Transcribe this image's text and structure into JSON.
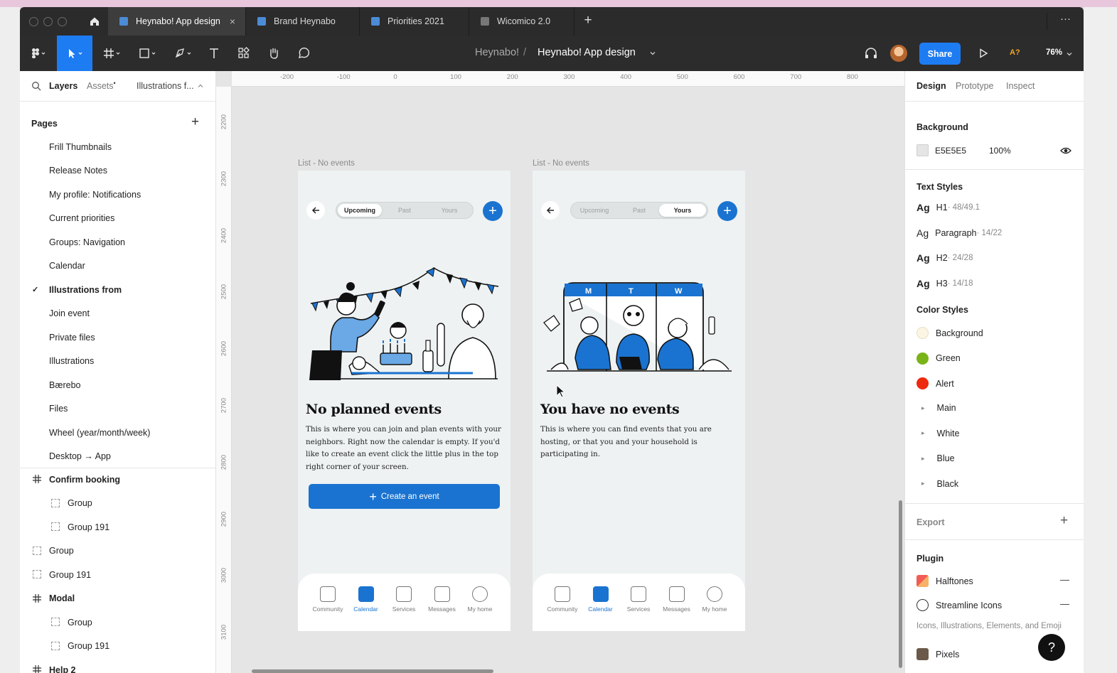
{
  "tabs": [
    {
      "label": "Heynabo! App design",
      "active": true
    },
    {
      "label": "Brand Heynabo"
    },
    {
      "label": "Priorities 2021"
    },
    {
      "label": "Wicomico 2.0"
    }
  ],
  "tabbar": {
    "close_glyph": "×",
    "new_tab_glyph": "+",
    "more_glyph": "···"
  },
  "toolbar": {
    "project": "Heynabo!",
    "separator": "/",
    "file": "Heynabo! App design",
    "share_label": "Share",
    "ai_label": "A?",
    "zoom": "76%"
  },
  "left_panel": {
    "tabs": {
      "layers": "Layers",
      "assets": "Assets",
      "assets_dot": "•",
      "current_page": "Illustrations f..."
    },
    "pages_title": "Pages",
    "add_glyph": "+",
    "pages": [
      "Frill Thumbnails",
      "Release Notes",
      "My profile: Notifications",
      "Current priorities",
      "Groups: Navigation",
      "Calendar",
      "Illustrations from",
      "Join event",
      "Private files",
      "Illustrations",
      "Bærebo",
      "Files",
      "Wheel (year/month/week)",
      "Desktop → App"
    ],
    "active_page": "Illustrations from",
    "check_glyph": "✓",
    "layers": [
      {
        "name": "Confirm booking",
        "kind": "frame",
        "indent": 0
      },
      {
        "name": "Group",
        "kind": "group",
        "indent": 1
      },
      {
        "name": "Group 191",
        "kind": "group",
        "indent": 1
      },
      {
        "name": "Group",
        "kind": "group",
        "indent": 0
      },
      {
        "name": "Group 191",
        "kind": "group",
        "indent": 0
      },
      {
        "name": "Modal",
        "kind": "frame",
        "indent": 0
      },
      {
        "name": "Group",
        "kind": "group",
        "indent": 1
      },
      {
        "name": "Group 191",
        "kind": "group",
        "indent": 1
      },
      {
        "name": "Help 2",
        "kind": "frame",
        "indent": 0
      }
    ]
  },
  "ruler": {
    "top": [
      "-200",
      "-100",
      "0",
      "100",
      "200",
      "300",
      "400",
      "500",
      "600",
      "700",
      "800"
    ],
    "left": [
      "2200",
      "2300",
      "2400",
      "2500",
      "2600",
      "2700",
      "2800",
      "2900",
      "3000",
      "3100"
    ]
  },
  "frames": [
    {
      "label": "List - No events",
      "segments": [
        "Upcoming",
        "Past",
        "Yours"
      ],
      "active_segment": 0,
      "title": "No planned events",
      "body": "This is where you can join and plan events with your neighbors. Right now the calendar is empty. If you'd like to create an event click the little plus in the top right corner of your screen.",
      "cta": "Create an event",
      "cta_plus": "+",
      "plus_glyph": "+",
      "illustration": "party-illustration",
      "nav": [
        "Community",
        "Calendar",
        "Services",
        "Messages",
        "My home"
      ],
      "active_nav": 1
    },
    {
      "label": "List - No events",
      "segments": [
        "Upcoming",
        "Past",
        "Yours"
      ],
      "active_segment": 2,
      "title": "You have no events",
      "body": "This is where you can find events that you are hosting, or that you and your household is participating in.",
      "plus_glyph": "+",
      "illustration": "calendar-illustration",
      "calendar_days": [
        "M",
        "T",
        "W"
      ],
      "nav": [
        "Community",
        "Calendar",
        "Services",
        "Messages",
        "My home"
      ],
      "active_nav": 1
    }
  ],
  "right_panel": {
    "tabs": [
      "Design",
      "Prototype",
      "Inspect"
    ],
    "background_title": "Background",
    "background_hex": "E5E5E5",
    "background_opacity": "100%",
    "text_styles_title": "Text Styles",
    "ag_label": "Ag",
    "text_styles": [
      {
        "name": "H1",
        "spec": " · 48/49.1"
      },
      {
        "name": "Paragraph",
        "spec": " · 14/22"
      },
      {
        "name": "H2",
        "spec": " · 24/28"
      },
      {
        "name": "H3",
        "spec": " · 14/18"
      }
    ],
    "color_styles_title": "Color Styles",
    "color_styles": [
      {
        "name": "Background",
        "color": "#fbf5e3"
      },
      {
        "name": "Green",
        "color": "#7ab317"
      },
      {
        "name": "Alert",
        "color": "#ee2a0f"
      }
    ],
    "folder_glyph": "▸",
    "color_groups": [
      "Main",
      "White",
      "Blue",
      "Black"
    ],
    "export_title": "Export",
    "plugin_title": "Plugin",
    "plugins": [
      "Halftones",
      "Streamline Icons"
    ],
    "plugin_desc": "Icons, Illustrations, Elements, and Emoji",
    "plugin_last": "Pixels",
    "help_glyph": "?",
    "minus_glyph": "—"
  },
  "colors": {
    "accent": "#1a73d0",
    "share": "#1e7cf2",
    "toolbar": "#2c2c2c"
  }
}
